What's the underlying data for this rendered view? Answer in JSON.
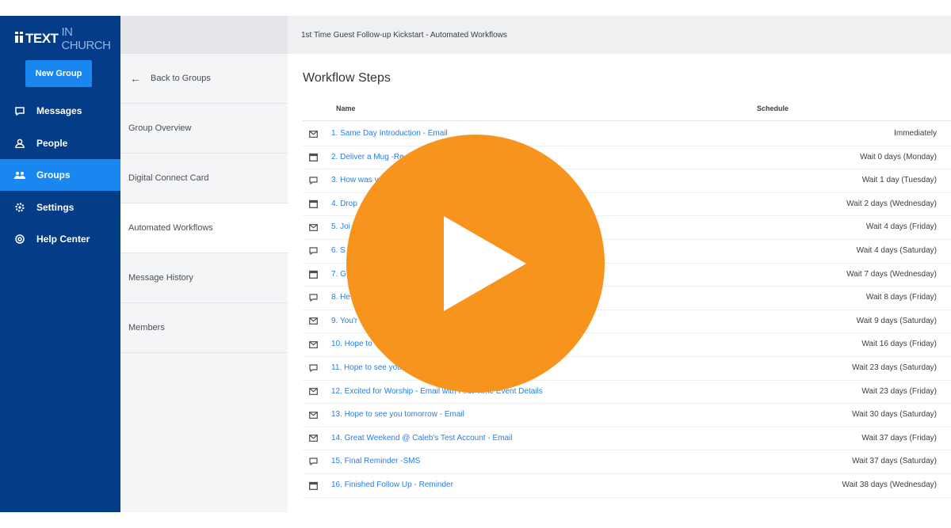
{
  "app": {
    "logo_main": "TEXT",
    "logo_light": "IN CHURCH"
  },
  "nav": {
    "new_group_label": "New Group",
    "items": [
      {
        "label": "Messages",
        "icon": "message-icon"
      },
      {
        "label": "People",
        "icon": "person-icon"
      },
      {
        "label": "Groups",
        "icon": "groups-icon",
        "active": true
      },
      {
        "label": "Settings",
        "icon": "gear-icon"
      },
      {
        "label": "Help Center",
        "icon": "help-icon"
      }
    ]
  },
  "group_menu": {
    "back_label": "Back to Groups",
    "items": [
      {
        "label": "Group Overview"
      },
      {
        "label": "Digital Connect Card"
      },
      {
        "label": "Automated Workflows",
        "active": true
      },
      {
        "label": "Message History"
      },
      {
        "label": "Members"
      }
    ]
  },
  "main": {
    "breadcrumb": "1st Time Guest Follow-up Kickstart - Automated Workflows",
    "section_title": "Workflow Steps",
    "columns": {
      "name": "Name",
      "schedule": "Schedule"
    },
    "steps": [
      {
        "icon": "email-icon",
        "name": "1. Same Day Introduction - Email",
        "schedule": "Immediately"
      },
      {
        "icon": "calendar-icon",
        "name": "2. Deliver a Mug -Re",
        "schedule": "Wait 0 days (Monday)"
      },
      {
        "icon": "sms-icon",
        "name": "3. How was y",
        "schedule": "Wait 1 day (Tuesday)"
      },
      {
        "icon": "calendar-icon",
        "name": "4. Drop",
        "schedule": "Wait 2 days (Wednesday)"
      },
      {
        "icon": "email-icon",
        "name": "5. Joi",
        "schedule": "Wait 4 days (Friday)"
      },
      {
        "icon": "sms-icon",
        "name": "6. S",
        "schedule": "Wait 4 days (Saturday)"
      },
      {
        "icon": "calendar-icon",
        "name": "7. G",
        "schedule": "Wait 7 days (Wednesday)"
      },
      {
        "icon": "sms-icon",
        "name": "8. He",
        "schedule": "Wait 8 days (Friday)"
      },
      {
        "icon": "email-icon",
        "name": "9. You'r",
        "schedule": "Wait 9 days (Saturday)"
      },
      {
        "icon": "email-icon",
        "name": "10. Hope to",
        "schedule": "Wait 16 days (Friday)"
      },
      {
        "icon": "sms-icon",
        "name": "11. Hope to see you",
        "schedule": "Wait 23 days (Saturday)"
      },
      {
        "icon": "email-icon",
        "name": "12. Excited for Worship - Email with First-Time Event Details",
        "schedule": "Wait 23 days (Friday)"
      },
      {
        "icon": "email-icon",
        "name": "13. Hope to see you tomorrow - Email",
        "schedule": "Wait 30 days (Saturday)"
      },
      {
        "icon": "email-icon",
        "name": "14. Great Weekend @ Caleb's Test Account - Email",
        "schedule": "Wait 37 days (Friday)"
      },
      {
        "icon": "sms-icon",
        "name": "15. Final Reminder -SMS",
        "schedule": "Wait 37 days (Saturday)"
      },
      {
        "icon": "calendar-icon",
        "name": "16. Finished Follow Up - Reminder",
        "schedule": "Wait 38 days (Wednesday)"
      }
    ]
  },
  "overlay": {
    "icon": "play-icon",
    "color": "#f7941d"
  },
  "colors": {
    "nav_bg": "#053c87",
    "accent": "#1a87f0",
    "link": "#2a7ee0"
  }
}
